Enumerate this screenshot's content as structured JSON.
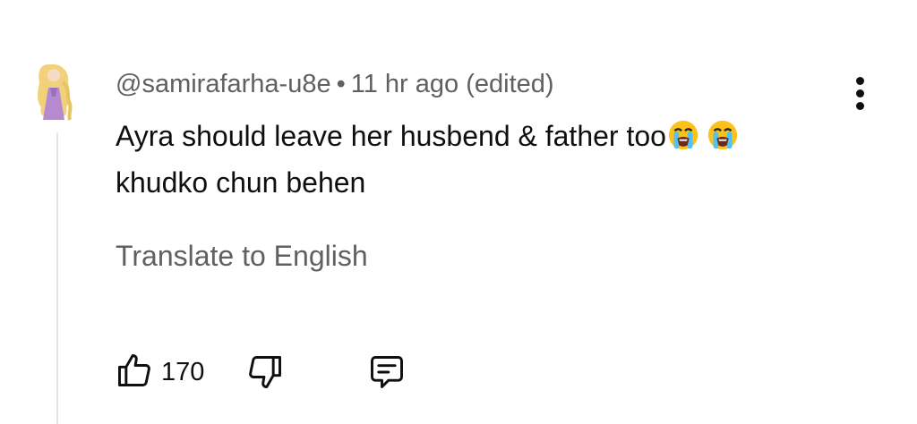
{
  "comment": {
    "handle": "@samirafarha-u8e",
    "separator": "•",
    "time": "11 hr ago (edited)",
    "text_line1": "Ayra should leave her husbend & father too",
    "text_line2": "khudko chun behen",
    "emojis": [
      "loudly-crying-face",
      "loudly-crying-face"
    ],
    "translate_label": "Translate to English",
    "like_count": "170"
  },
  "icons": {
    "like": "thumbs-up-icon",
    "dislike": "thumbs-down-icon",
    "reply": "comment-reply-icon",
    "more": "more-vertical-icon"
  },
  "colors": {
    "text": "#0f0f0f",
    "secondary": "#606060",
    "emoji": "#fcc21b",
    "tears": "#4fc3f7"
  }
}
